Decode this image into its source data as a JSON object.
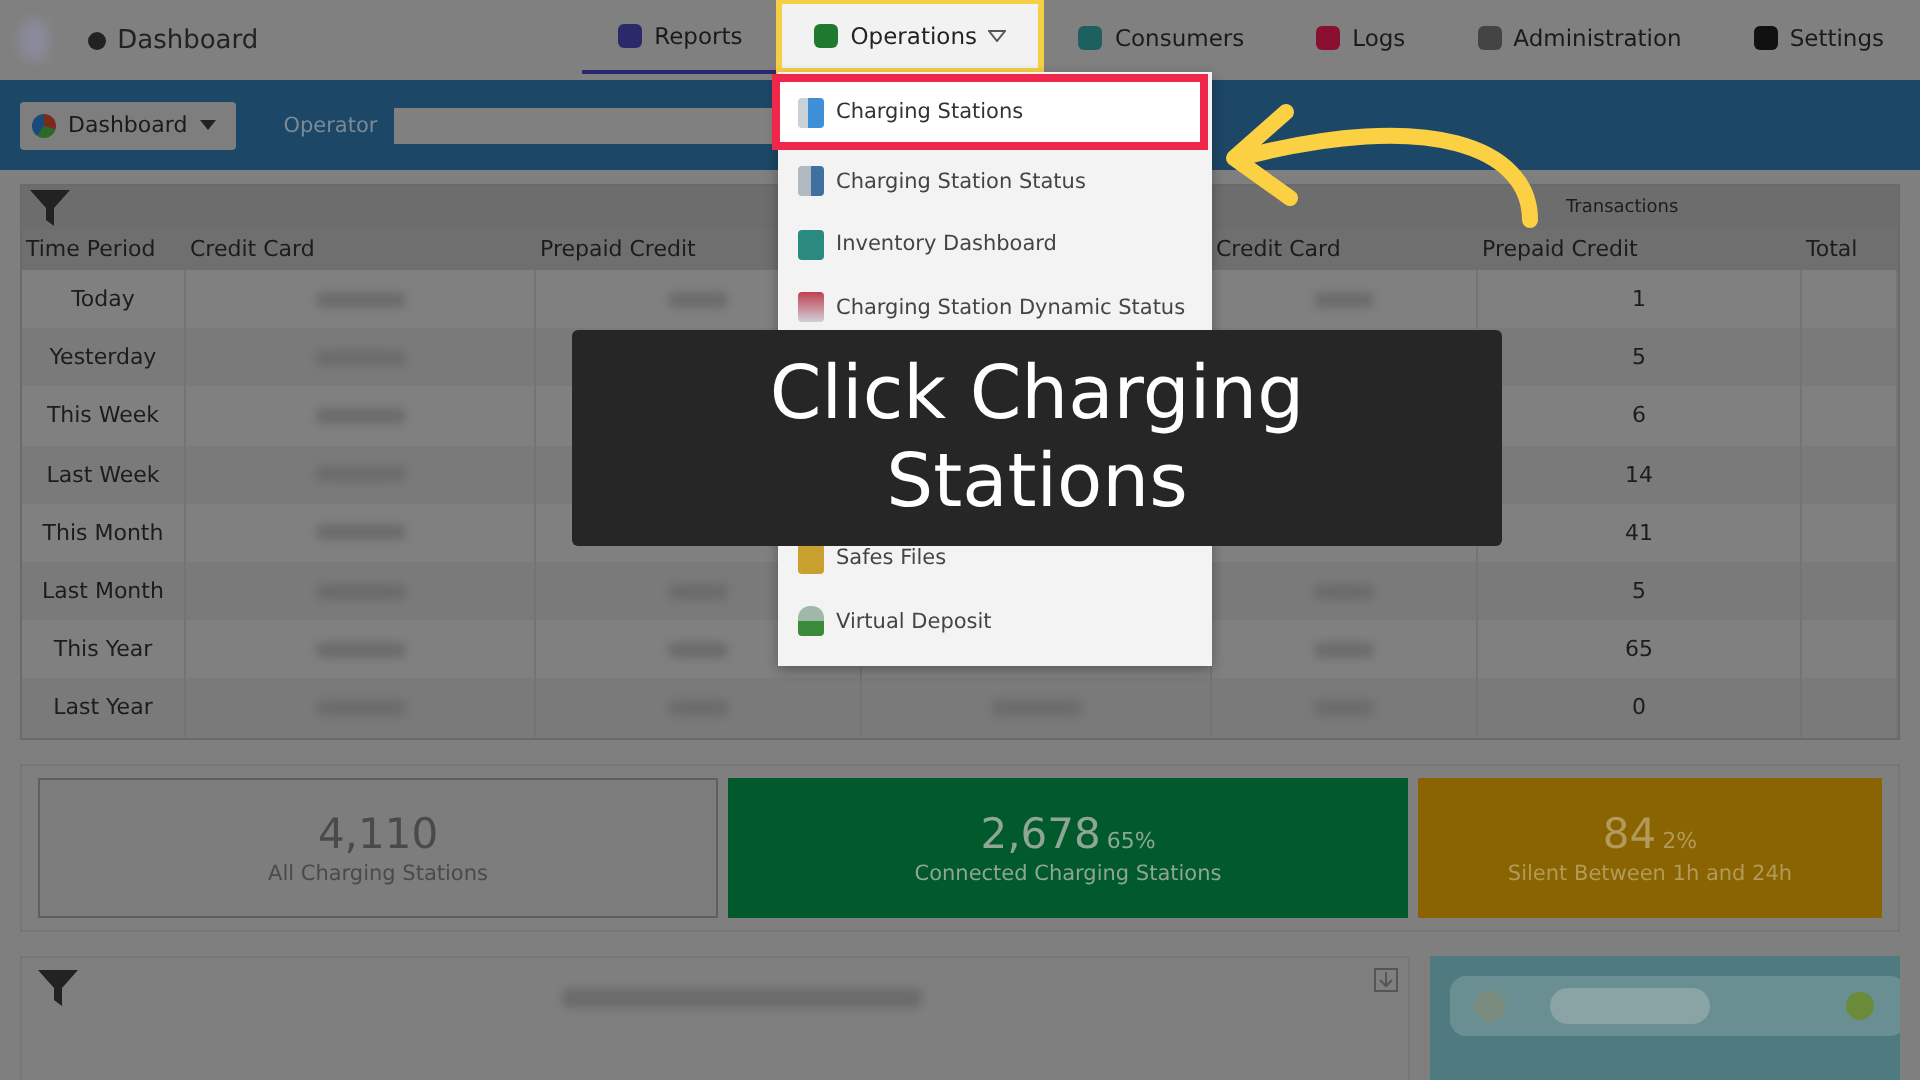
{
  "header": {
    "page_title": "Dashboard"
  },
  "nav": [
    {
      "label": "Reports",
      "selected": true,
      "open": false
    },
    {
      "label": "Operations",
      "selected": false,
      "open": true
    },
    {
      "label": "Consumers",
      "selected": false,
      "open": false
    },
    {
      "label": "Logs",
      "selected": false,
      "open": false
    },
    {
      "label": "Administration",
      "selected": false,
      "open": false
    },
    {
      "label": "Settings",
      "selected": false,
      "open": false
    }
  ],
  "toolbar": {
    "view_button": "Dashboard",
    "operator_label": "Operator"
  },
  "menu": {
    "groups": [
      [
        {
          "label": "Charging Stations",
          "selected": true
        },
        {
          "label": "Charging Station Status",
          "selected": false
        },
        {
          "label": "Inventory Dashboard",
          "selected": false
        },
        {
          "label": "Charging Station Dynamic Status",
          "selected": false
        }
      ],
      [
        {
          "label": "Safes Files",
          "selected": false
        },
        {
          "label": "Virtual Deposit",
          "selected": false
        }
      ]
    ]
  },
  "table": {
    "group_heading": "Transactions",
    "columns": [
      "Time Period",
      "Credit Card",
      "Prepaid Credit",
      "Credit Card",
      "Prepaid Credit",
      "Total"
    ],
    "rows": [
      {
        "period": "Today",
        "prepaid": "1"
      },
      {
        "period": "Yesterday",
        "prepaid": "5"
      },
      {
        "period": "This Week",
        "prepaid": "6"
      },
      {
        "period": "Last Week",
        "prepaid": "14"
      },
      {
        "period": "This Month",
        "prepaid": "41"
      },
      {
        "period": "Last Month",
        "prepaid": "5"
      },
      {
        "period": "This Year",
        "prepaid": "65"
      },
      {
        "period": "Last Year",
        "prepaid": "0"
      }
    ]
  },
  "cards": [
    {
      "kind": "all",
      "value": "4,110",
      "label": "All Charging Stations"
    },
    {
      "kind": "connected",
      "value": "2,678",
      "percent": "65%",
      "label": "Connected Charging Stations"
    },
    {
      "kind": "silent",
      "value": "84",
      "percent": "2%",
      "label": "Silent Between 1h and 24h"
    }
  ],
  "caption": "Click Charging Stations"
}
